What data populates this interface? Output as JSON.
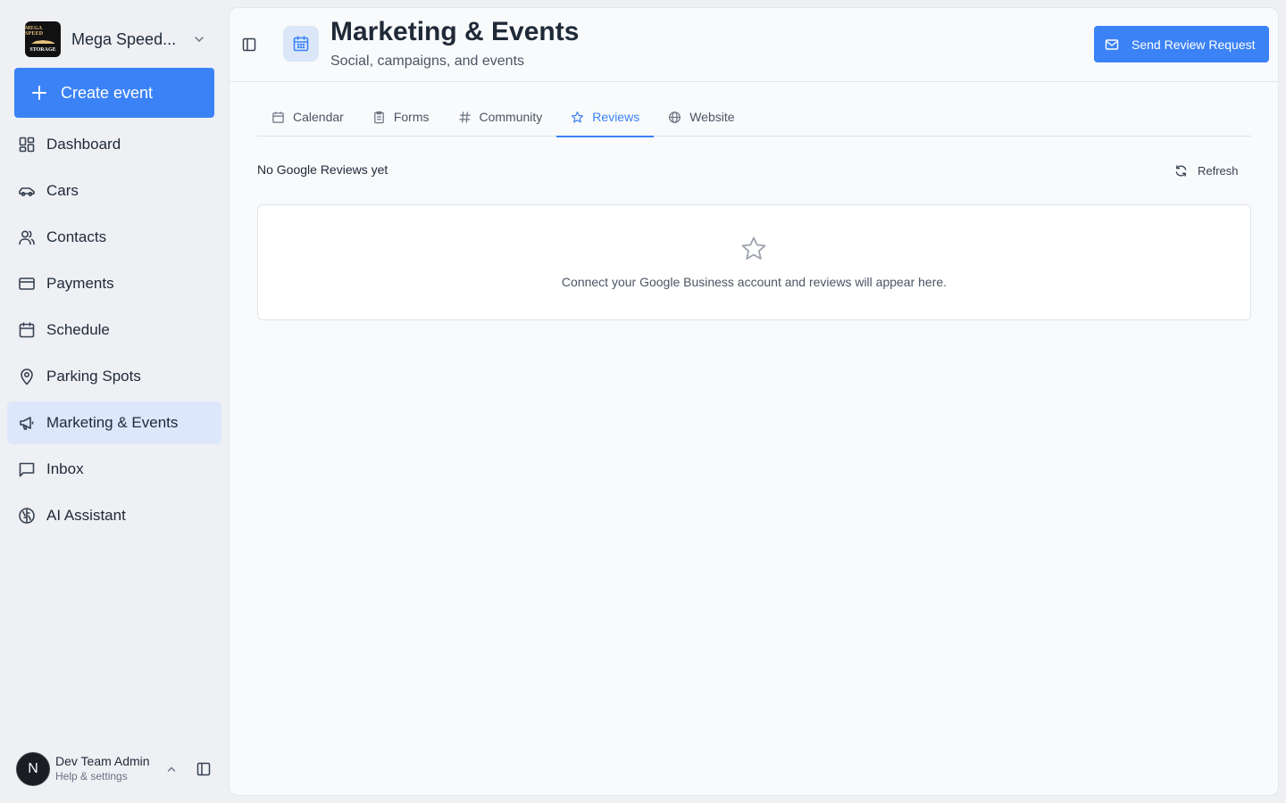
{
  "org": {
    "name": "Mega Speed...",
    "logo_line1": "MEGA SPEED",
    "logo_line2": "STORAGE"
  },
  "sidebar": {
    "create_label": "Create event",
    "items": [
      {
        "label": "Dashboard",
        "icon": "dashboard-icon"
      },
      {
        "label": "Cars",
        "icon": "car-icon"
      },
      {
        "label": "Contacts",
        "icon": "contacts-icon"
      },
      {
        "label": "Payments",
        "icon": "credit-card-icon"
      },
      {
        "label": "Schedule",
        "icon": "calendar-icon"
      },
      {
        "label": "Parking Spots",
        "icon": "map-pin-icon"
      },
      {
        "label": "Marketing & Events",
        "icon": "megaphone-icon",
        "active": true
      },
      {
        "label": "Inbox",
        "icon": "message-icon"
      },
      {
        "label": "AI Assistant",
        "icon": "brain-icon"
      }
    ]
  },
  "user": {
    "initial": "N",
    "name": "Dev Team Admin",
    "subtitle": "Help & settings"
  },
  "header": {
    "title": "Marketing & Events",
    "subtitle": "Social, campaigns, and events",
    "send_label": "Send Review Request"
  },
  "tabs": [
    {
      "label": "Calendar",
      "icon": "calendar-icon"
    },
    {
      "label": "Forms",
      "icon": "clipboard-icon"
    },
    {
      "label": "Community",
      "icon": "hash-icon"
    },
    {
      "label": "Reviews",
      "icon": "star-icon",
      "active": true
    },
    {
      "label": "Website",
      "icon": "globe-icon"
    }
  ],
  "reviews": {
    "status": "No Google Reviews yet",
    "refresh_label": "Refresh",
    "empty_message": "Connect your Google Business account and reviews will appear here."
  },
  "colors": {
    "accent": "#3b82f6",
    "active_nav_bg": "#dde7fb",
    "page_bg": "#f8fafc"
  }
}
